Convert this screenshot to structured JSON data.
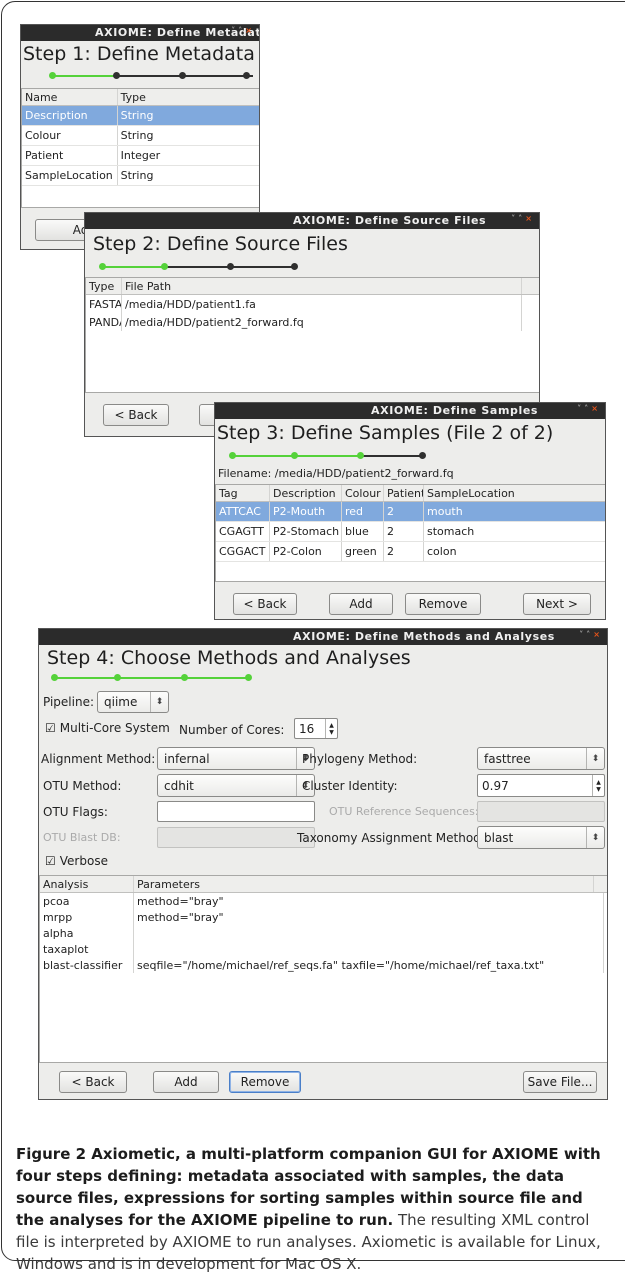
{
  "window_controls": {
    "min": "˅",
    "max": "˄",
    "close": "×"
  },
  "win1": {
    "title": "AXIOME: Define Metadata",
    "step": "Step 1: Define Metadata",
    "progress": [
      true,
      false,
      false,
      false
    ],
    "headers": [
      "Name",
      "Type"
    ],
    "rows": [
      [
        "Description",
        "String"
      ],
      [
        "Colour",
        "String"
      ],
      [
        "Patient",
        "Integer"
      ],
      [
        "SampleLocation",
        "String"
      ]
    ],
    "add_label": "Add"
  },
  "win2": {
    "title": "AXIOME: Define Source Files",
    "step": "Step 2: Define Source Files",
    "progress": [
      true,
      true,
      false,
      false
    ],
    "headers": [
      "Type",
      "File Path"
    ],
    "rows": [
      [
        "FASTA",
        "/media/HDD/patient1.fa"
      ],
      [
        "PANDA",
        "/media/HDD/patient2_forward.fq"
      ]
    ],
    "back_label": "< Back"
  },
  "win3": {
    "title": "AXIOME: Define Samples",
    "step": "Step 3: Define Samples (File 2 of 2)",
    "progress": [
      true,
      true,
      true,
      false
    ],
    "filename": "Filename: /media/HDD/patient2_forward.fq",
    "headers": [
      "Tag",
      "Description",
      "Colour",
      "Patient",
      "SampleLocation"
    ],
    "rows": [
      [
        "ATTCAC",
        "P2-Mouth",
        "red",
        "2",
        "mouth"
      ],
      [
        "CGAGTT",
        "P2-Stomach",
        "blue",
        "2",
        "stomach"
      ],
      [
        "CGGACT",
        "P2-Colon",
        "green",
        "2",
        "colon"
      ]
    ],
    "back_label": "< Back",
    "add_label": "Add",
    "remove_label": "Remove",
    "next_label": "Next >"
  },
  "win4": {
    "title": "AXIOME: Define Methods and Analyses",
    "step": "Step 4: Choose Methods and Analyses",
    "progress": [
      true,
      true,
      true,
      true
    ],
    "pipeline_label": "Pipeline:",
    "pipeline_value": "qiime",
    "multicore_label": "Multi-Core System",
    "cores_label": "Number of Cores:",
    "cores_value": "16",
    "alignment_label": "Alignment Method:",
    "alignment_value": "infernal",
    "phylogeny_label": "Phylogeny Method:",
    "phylogeny_value": "fasttree",
    "otu_method_label": "OTU Method:",
    "otu_method_value": "cdhit",
    "cluster_label": "Cluster Identity:",
    "cluster_value": "0.97",
    "otu_flags_label": "OTU Flags:",
    "otu_flags_value": "",
    "otu_ref_label": "OTU Reference Sequences:",
    "otu_ref_value": "",
    "otu_blast_label": "OTU Blast DB:",
    "otu_blast_value": "",
    "taxonomy_label": "Taxonomy Assignment Method:",
    "taxonomy_value": "blast",
    "verbose_label": "Verbose",
    "headers": [
      "Analysis",
      "Parameters"
    ],
    "rows": [
      [
        "pcoa",
        "method=\"bray\""
      ],
      [
        "mrpp",
        "method=\"bray\""
      ],
      [
        "alpha",
        ""
      ],
      [
        "taxaplot",
        ""
      ],
      [
        "blast-classifier",
        "seqfile=\"/home/michael/ref_seqs.fa\" taxfile=\"/home/michael/ref_taxa.txt\""
      ]
    ],
    "back_label": "< Back",
    "add_label": "Add",
    "remove_label": "Remove",
    "save_label": "Save File..."
  },
  "caption": {
    "bold": "Figure 2 Axiometic, a multi-platform companion GUI for AXIOME with four steps defining: metadata associated with samples, the data source files, expressions for sorting samples within source file and the analyses for the AXIOME pipeline to run.",
    "text": " The resulting XML control file is interpreted by AXIOME to run analyses. Axiometic is available for Linux, Windows and is in development for Mac OS X."
  },
  "colors": {
    "accent_green": "#55d23a",
    "selection": "#80a9dd",
    "titlebar": "#2b2b2b",
    "close": "#e8541a"
  }
}
